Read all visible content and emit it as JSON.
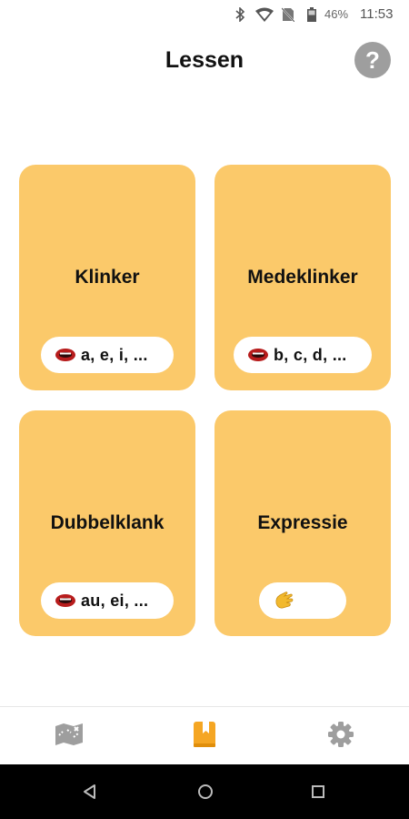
{
  "status_bar": {
    "battery_percent": "46%",
    "time": "11:53",
    "icons": [
      "bluetooth-icon",
      "wifi-icon",
      "no-sim-icon",
      "battery-icon"
    ]
  },
  "header": {
    "title": "Lessen",
    "help_icon": "question-mark-icon",
    "help_label": "?"
  },
  "cards": [
    {
      "title": "Klinker",
      "pill_text": "a, e, i, ...",
      "pill_icon": "mouth-icon"
    },
    {
      "title": "Medeklinker",
      "pill_text": "b, c, d, ...",
      "pill_icon": "mouth-icon"
    },
    {
      "title": "Dubbelklank",
      "pill_text": "au, ei, ...",
      "pill_icon": "mouth-icon"
    },
    {
      "title": "Expressie",
      "pill_text": "",
      "pill_icon": "hand-icon"
    }
  ],
  "bottom_nav": {
    "items": [
      {
        "icon": "map-icon",
        "active": false
      },
      {
        "icon": "book-icon",
        "active": true
      },
      {
        "icon": "gear-icon",
        "active": false
      }
    ]
  },
  "colors": {
    "card_background": "#fbc96a",
    "accent": "#f5a623",
    "inactive_icon": "#9e9e9e"
  }
}
